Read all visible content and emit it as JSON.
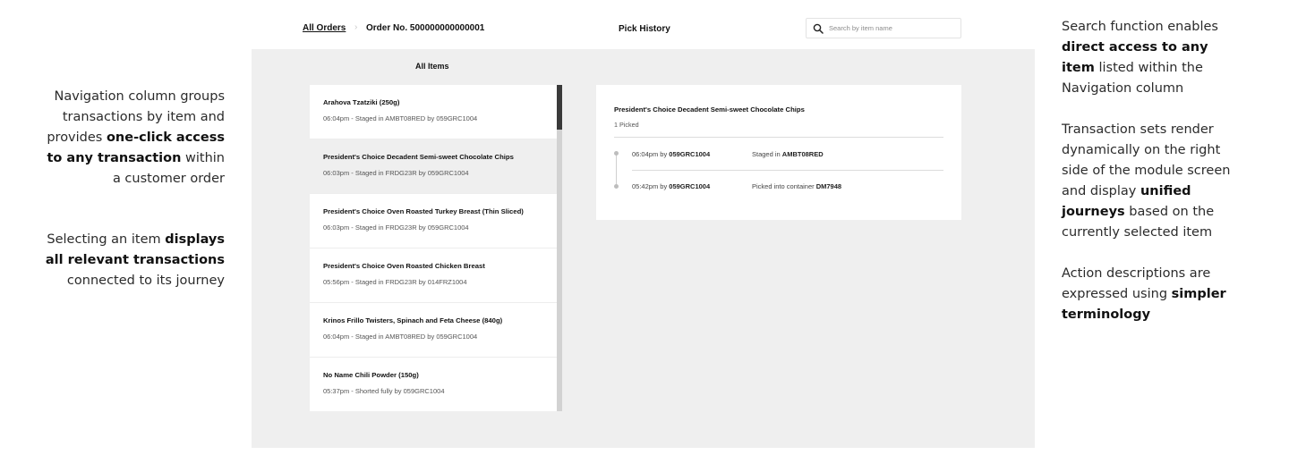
{
  "annotations": {
    "left": [
      {
        "parts": [
          {
            "t": "Navigation column groups transactions by item and provides ",
            "b": false
          },
          {
            "t": "one-click access to any transaction",
            "b": true
          },
          {
            "t": " within a customer order",
            "b": false
          }
        ]
      },
      {
        "parts": [
          {
            "t": "Selecting an item ",
            "b": false
          },
          {
            "t": "displays all relevant transactions",
            "b": true
          },
          {
            "t": " connected to its journey",
            "b": false
          }
        ]
      }
    ],
    "right": [
      {
        "parts": [
          {
            "t": "Search function enables ",
            "b": false
          },
          {
            "t": "direct access to any item",
            "b": true
          },
          {
            "t": " listed within the Navigation column",
            "b": false
          }
        ]
      },
      {
        "parts": [
          {
            "t": "Transaction sets render dynamically on the right side of the module screen and display ",
            "b": false
          },
          {
            "t": "unified journeys",
            "b": true
          },
          {
            "t": " based on the currently selected item",
            "b": false
          }
        ]
      },
      {
        "parts": [
          {
            "t": "Action descriptions are expressed using ",
            "b": false
          },
          {
            "t": "simpler terminology",
            "b": true
          }
        ]
      }
    ]
  },
  "header": {
    "breadcrumb_all": "All Orders",
    "breadcrumb_sep": "›",
    "breadcrumb_order": "Order No. 500000000000001",
    "title": "Pick History",
    "search_placeholder": "Search by item name",
    "search_icon": "search-icon"
  },
  "nav": {
    "heading": "All Items",
    "items": [
      {
        "name": "Arahova Tzatziki (250g)",
        "meta": "06:04pm - Staged in AMBT08RED by 059GRC1004",
        "selected": false
      },
      {
        "name": "President's Choice Decadent Semi-sweet Chocolate Chips",
        "meta": "06:03pm - Staged in FRDG23R by 059GRC1004",
        "selected": true
      },
      {
        "name": "President's Choice Oven Roasted Turkey Breast (Thin Sliced)",
        "meta": "06:03pm - Staged in FRDG23R by 059GRC1004",
        "selected": false
      },
      {
        "name": "President's Choice Oven Roasted Chicken Breast",
        "meta": "05:56pm - Staged in FRDG23R by 014FRZ1004",
        "selected": false
      },
      {
        "name": "Krinos Frillo Twisters, Spinach and Feta Cheese (840g)",
        "meta": "06:04pm - Staged in AMBT08RED by 059GRC1004",
        "selected": false
      },
      {
        "name": "No Name Chili Powder (150g)",
        "meta": "05:37pm - Shorted fully by 059GRC1004",
        "selected": false
      }
    ]
  },
  "detail": {
    "title": "President's Choice Decadent Semi-sweet Chocolate Chips",
    "subtitle": "1 Picked",
    "events": [
      {
        "time": "06:04pm by ",
        "user": "059GRC1004",
        "action": "Staged in ",
        "target": "AMBT08RED"
      },
      {
        "time": "05:42pm by ",
        "user": "059GRC1004",
        "action": "Picked into container ",
        "target": "DM7948"
      }
    ]
  },
  "colors": {
    "panel_bg": "#efefef",
    "selected_row": "#efefef",
    "scroll_thumb": "#3a3a3a",
    "scroll_track": "#d2d2d2"
  }
}
